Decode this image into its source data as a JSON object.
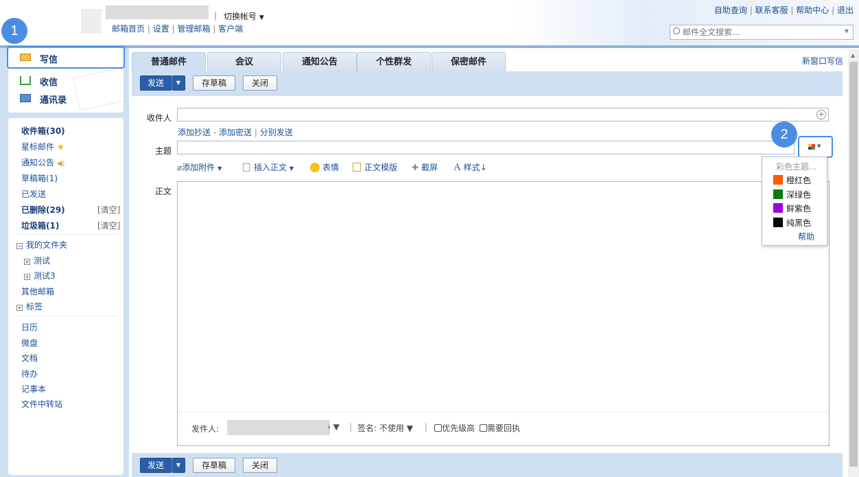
{
  "header": {
    "switch_account": "切换帐号",
    "links": [
      "邮箱首页",
      "设置",
      "管理邮箱",
      "客户端"
    ],
    "top_links": [
      "自助查询",
      "联系客服",
      "帮助中心",
      "退出"
    ],
    "search_placeholder": "邮件全文搜索..."
  },
  "side": {
    "compose": "写信",
    "inbox": "收信",
    "contacts": "通讯录",
    "folders": [
      {
        "label": "收件箱(30)",
        "bold": true
      },
      {
        "label": "星标邮件",
        "bold": false
      },
      {
        "label": "通知公告",
        "bold": false
      },
      {
        "label": "草稿箱(1)",
        "bold": false
      },
      {
        "label": "已发送",
        "bold": false
      },
      {
        "label": "已删除(29)",
        "bold": true,
        "clear": "[清空]"
      },
      {
        "label": "垃圾箱(1)",
        "bold": true,
        "clear": "[清空]"
      }
    ],
    "my_folders": "我的文件夹",
    "sub_folders": [
      "测试",
      "测试3"
    ],
    "other_mail": "其他邮箱",
    "tags": "标签",
    "apps": [
      "日历",
      "微盘",
      "文档",
      "待办",
      "记事本",
      "文件中转站"
    ]
  },
  "tabs": [
    "普通邮件",
    "会议",
    "通知公告",
    "个性群发",
    "保密邮件"
  ],
  "new_window": "新窗口写信",
  "toolbar": {
    "send": "发送",
    "save_draft": "存草稿",
    "close": "关闭"
  },
  "form": {
    "to_label": "收件人",
    "cc_links": [
      "添加抄送",
      "添加密送",
      "分别发送"
    ],
    "subject_label": "主题",
    "body_label": "正文",
    "editor_tools": [
      "添加附件",
      "插入正文",
      "表情",
      "正文模版",
      "截屏",
      "样式"
    ]
  },
  "color_menu": {
    "title": "彩色主题...",
    "options": [
      {
        "label": "橙红色",
        "color": "#ff5a00"
      },
      {
        "label": "深绿色",
        "color": "#0b7a12"
      },
      {
        "label": "鲜紫色",
        "color": "#a000e0"
      },
      {
        "label": "纯黑色",
        "color": "#000000"
      }
    ],
    "help": "帮助"
  },
  "footer": {
    "sender_label": "发件人:",
    "signature": "签名: 不使用",
    "priority": "优先级高",
    "receipt": "需要回执"
  },
  "badges": [
    "1",
    "2"
  ]
}
